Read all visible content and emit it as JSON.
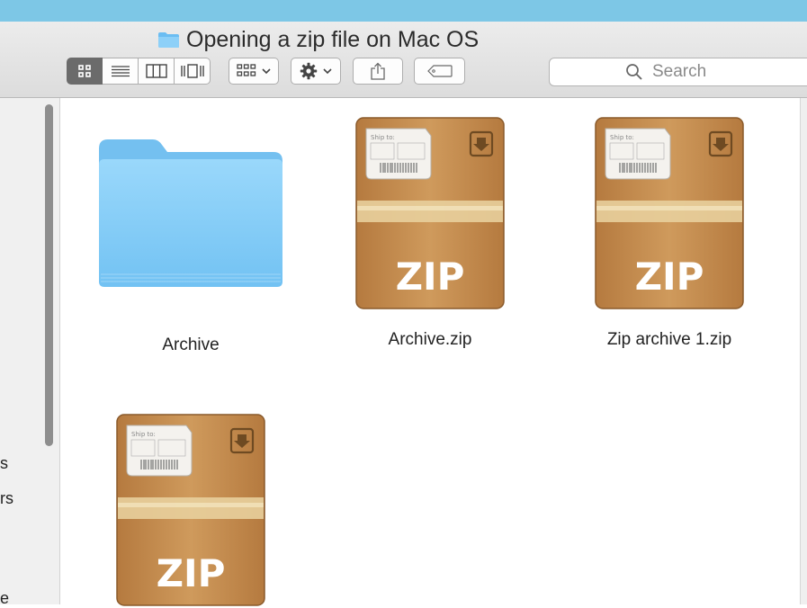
{
  "window": {
    "title": "Opening a zip file on Mac OS"
  },
  "toolbar": {
    "view_modes": [
      "icon-view",
      "list-view",
      "column-view",
      "cover-flow-view"
    ],
    "arrange_icon": "arrange-icon",
    "action_icon": "gear-icon",
    "share_icon": "share-icon",
    "tag_icon": "tag-icon"
  },
  "search": {
    "placeholder": "Search"
  },
  "sidebar": {
    "fragments": [
      "s",
      "rs",
      "e"
    ]
  },
  "files": [
    {
      "name": "Archive",
      "kind": "folder"
    },
    {
      "name": "Archive.zip",
      "kind": "zip",
      "badge": "ZIP"
    },
    {
      "name": "Zip archive 1.zip",
      "kind": "zip",
      "badge": "ZIP"
    },
    {
      "name": "",
      "kind": "zip",
      "badge": "ZIP"
    }
  ],
  "zip_label": {
    "ship_to": "Ship to:"
  },
  "colors": {
    "sky": "#7dc7e6",
    "folder": "#7cc8f6",
    "box": "#c2894a"
  }
}
